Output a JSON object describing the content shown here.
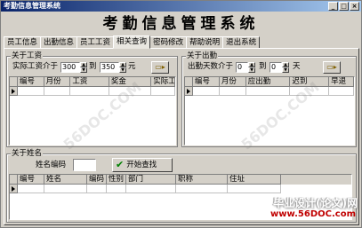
{
  "window": {
    "title": "考勤信息管理系统",
    "buttons": [
      "_",
      "□",
      "×"
    ]
  },
  "banner": {
    "text": "考勤信息管理系统"
  },
  "tabs": [
    {
      "label": "员工信息"
    },
    {
      "label": "出勤信息"
    },
    {
      "label": "员工工资"
    },
    {
      "label": "相关查询"
    },
    {
      "label": "密码修改"
    },
    {
      "label": "帮助说明"
    },
    {
      "label": "退出系统"
    }
  ],
  "salary_group": {
    "title": "关于工资",
    "range_label": "实际工资介于",
    "min_value": "300",
    "to_label": "到",
    "max_value": "350",
    "unit": "元",
    "columns": [
      "编号",
      "月份",
      "工资",
      "奖金",
      "实际工"
    ]
  },
  "attendance_group": {
    "title": "关于出勤",
    "range_label": "出勤天数介于",
    "min_value": "0",
    "to_label": "到",
    "max_value": "0",
    "unit": "天",
    "columns": [
      "编号",
      "月份",
      "应出勤",
      "迟到",
      "早退"
    ]
  },
  "name_group": {
    "title": "关于姓名",
    "name_label": "姓名编码",
    "name_value": "",
    "search_button": "开始查找",
    "columns": [
      "编号",
      "姓名",
      "编码",
      "性别",
      "部门",
      "职称",
      "住址"
    ]
  },
  "watermark": {
    "site_text": "毕业设计(论文)网",
    "site_url": "www.56DOC.com",
    "diagonal": "56DOC.COM"
  }
}
